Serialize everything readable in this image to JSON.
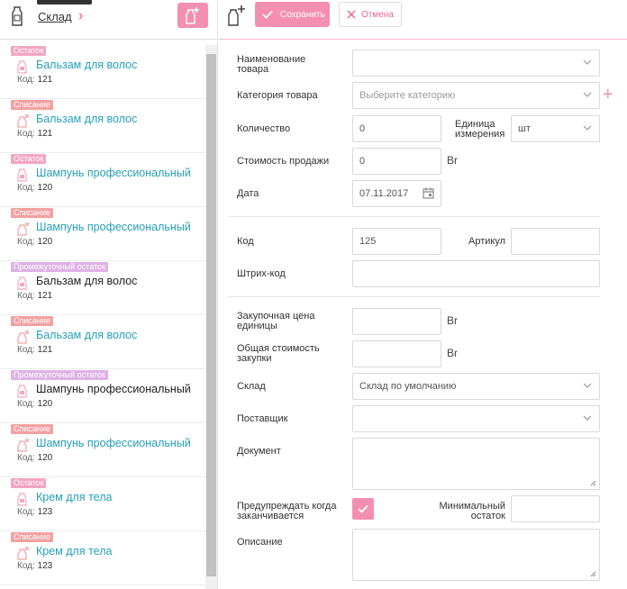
{
  "sidebar": {
    "store_label": "Склад",
    "items": [
      {
        "badge": "Остаток",
        "type": "ostatok",
        "name": "Бальзам для волос",
        "code_label": "Код:",
        "code": "121",
        "highlight": true
      },
      {
        "badge": "Списание",
        "type": "spisanie",
        "name": "Бальзам для волос",
        "code_label": "Код:",
        "code": "121",
        "highlight": true
      },
      {
        "badge": "Остаток",
        "type": "ostatok",
        "name": "Шампунь профессиональный",
        "code_label": "Код:",
        "code": "120",
        "highlight": true
      },
      {
        "badge": "Списание",
        "type": "spisanie",
        "name": "Шампунь профессиональный",
        "code_label": "Код:",
        "code": "120",
        "highlight": true
      },
      {
        "badge": "Промежуточный остаток",
        "type": "promeg",
        "name": "Бальзам для волос",
        "code_label": "Код:",
        "code": "121",
        "highlight": false
      },
      {
        "badge": "Списание",
        "type": "spisanie",
        "name": "Бальзам для волос",
        "code_label": "Код:",
        "code": "121",
        "highlight": true
      },
      {
        "badge": "Промежуточный остаток",
        "type": "promeg",
        "name": "Шампунь профессиональный",
        "code_label": "Код:",
        "code": "120",
        "highlight": false
      },
      {
        "badge": "Списание",
        "type": "spisanie",
        "name": "Шампунь профессиональный",
        "code_label": "Код:",
        "code": "120",
        "highlight": true
      },
      {
        "badge": "Остаток",
        "type": "ostatok",
        "name": "Крем для тела",
        "code_label": "Код:",
        "code": "123",
        "highlight": true
      },
      {
        "badge": "Списание",
        "type": "spisanie",
        "name": "Крем для тела",
        "code_label": "Код:",
        "code": "123",
        "highlight": true
      }
    ]
  },
  "toolbar": {
    "save_label": "Сохранить",
    "cancel_label": "Отмена"
  },
  "form": {
    "product_name": {
      "label_1": "Наименование",
      "label_2": "товара",
      "value": ""
    },
    "category": {
      "label": "Категория товара",
      "placeholder": "Выберите категорию"
    },
    "quantity": {
      "label": "Количество",
      "value": "0"
    },
    "unit": {
      "label_1": "Единица",
      "label_2": "измерения",
      "value": "шт"
    },
    "sale_price": {
      "label": "Стоимость продажи",
      "value": "0",
      "currency": "Br"
    },
    "date": {
      "label": "Дата",
      "value": "07.11.2017"
    },
    "code": {
      "label": "Код",
      "value": "125"
    },
    "article": {
      "label": "Артикул",
      "value": ""
    },
    "barcode": {
      "label": "Штрих-код",
      "value": ""
    },
    "purchase_price": {
      "label_1": "Закупочная цена",
      "label_2": "единицы",
      "value": "",
      "currency": "Br"
    },
    "total_purchase": {
      "label_1": "Общая стоимость",
      "label_2": "закупки",
      "value": "",
      "currency": "Br"
    },
    "warehouse": {
      "label": "Склад",
      "value": "Склад по умолчанию"
    },
    "supplier": {
      "label": "Поставщик",
      "value": ""
    },
    "document": {
      "label": "Документ",
      "value": ""
    },
    "warn": {
      "label_1": "Предупреждать когда",
      "label_2": "заканчивается",
      "checked": true
    },
    "min_stock": {
      "label_1": "Минимальный",
      "label_2": "остаток",
      "value": ""
    },
    "description": {
      "label": "Описание",
      "value": ""
    }
  },
  "colors": {
    "accent": "#f48fb1",
    "link": "#26a0b8"
  }
}
